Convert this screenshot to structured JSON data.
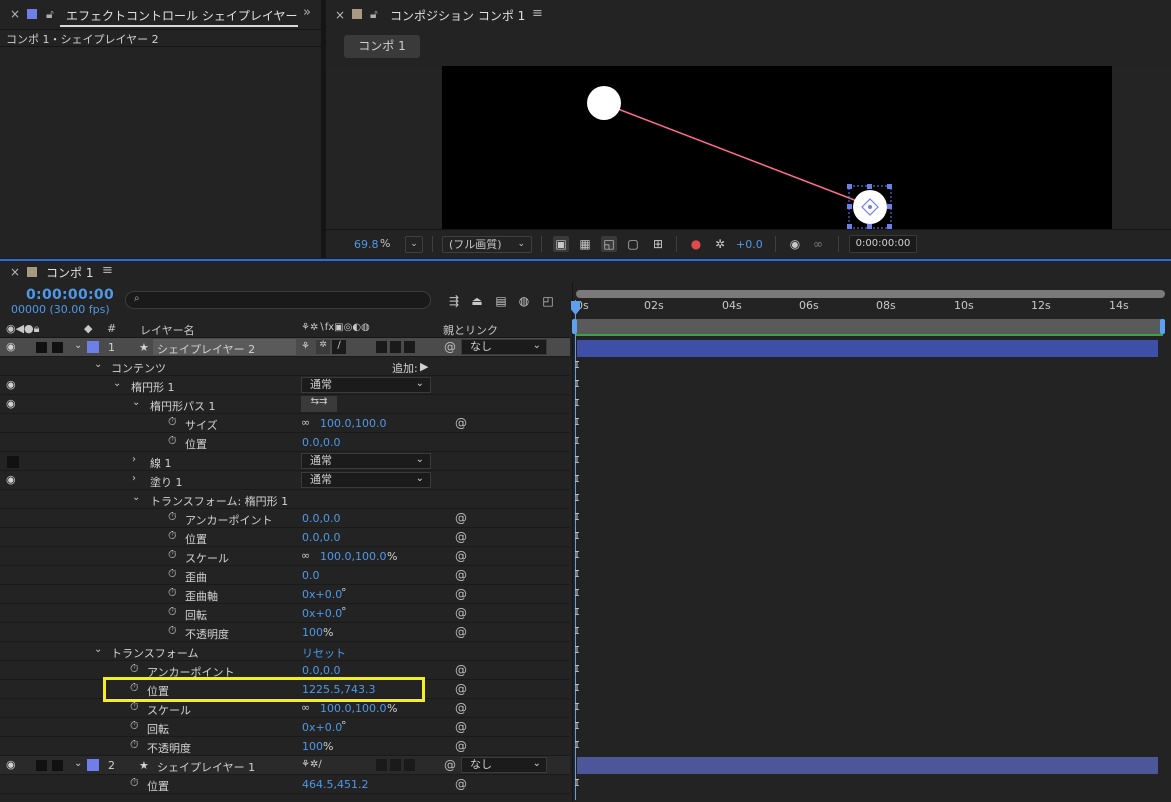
{
  "colors": {
    "accent_blue": "#4f98e7",
    "layer_label_blue": "#6f7fe8",
    "composition_bg": "#000000",
    "path_line": "#ff6b8a",
    "highlight_yellow": "#f4ef20",
    "layer_bar": "#3e4fa8"
  },
  "effects_panel": {
    "close": "×",
    "tab_title": "エフェクトコントロール シェイプレイヤー",
    "overflow": "»",
    "subtitle": "コンポ 1・シェイプレイヤー 2"
  },
  "comp_panel": {
    "close": "×",
    "tab_title": "コンポジション コンポ 1",
    "menu": "≡",
    "flow_button": "コンポ 1",
    "toolbar": {
      "zoom": "69.8",
      "zoom_unit": "%",
      "resolution": "(フル画質)",
      "exposure": "+0.0",
      "timecode": "0:00:00:00"
    }
  },
  "timeline": {
    "tab_close": "×",
    "tab_title": "コンポ 1",
    "menu": "≡",
    "timecode": "0:00:00:00",
    "frames": "00000 (30.00 fps)",
    "search_placeholder": "",
    "header": {
      "num": "#",
      "layer_name": "レイヤー名",
      "switches": "⚘✲∖fx▣◎◐◍",
      "parent": "親とリンク"
    },
    "ruler_ticks": [
      "0s",
      "02s",
      "04s",
      "06s",
      "08s",
      "10s",
      "12s",
      "14s"
    ],
    "layer1": {
      "number": "1",
      "name": "シェイプレイヤー 2",
      "parent": "なし",
      "contents": "コンテンツ",
      "add": "追加:",
      "ellipse": "楕円形 1",
      "ellipse_mode": "通常",
      "ellipse_path": "楕円形パス 1",
      "size_label": "サイズ",
      "size_value": "100.0,100.0",
      "path_pos_label": "位置",
      "path_pos_value": "0.0,0.0",
      "stroke": "線 1",
      "stroke_mode": "通常",
      "fill": "塗り 1",
      "fill_mode": "通常",
      "ellipse_transform": "トランスフォーム: 楕円形 1",
      "et_anchor_label": "アンカーポイント",
      "et_anchor_value": "0.0,0.0",
      "et_pos_label": "位置",
      "et_pos_value": "0.0,0.0",
      "et_scale_label": "スケール",
      "et_scale_value": "100.0,100.0",
      "et_scale_unit": "%",
      "et_skew_label": "歪曲",
      "et_skew_value": "0.0",
      "et_skew_axis_label": "歪曲軸",
      "et_skew_axis_value": "0x+0.0",
      "et_skew_axis_unit": "°",
      "et_rot_label": "回転",
      "et_rot_value": "0x+0.0",
      "et_rot_unit": "°",
      "et_opacity_label": "不透明度",
      "et_opacity_value": "100",
      "et_opacity_unit": "%",
      "transform": "トランスフォーム",
      "reset": "リセット",
      "t_anchor_label": "アンカーポイント",
      "t_anchor_value": "0.0,0.0",
      "t_pos_label": "位置",
      "t_pos_value": "1225.5,743.3",
      "t_scale_label": "スケール",
      "t_scale_value": "100.0,100.0",
      "t_scale_unit": "%",
      "t_rot_label": "回転",
      "t_rot_value": "0x+0.0",
      "t_rot_unit": "°",
      "t_opacity_label": "不透明度",
      "t_opacity_value": "100",
      "t_opacity_unit": "%"
    },
    "layer2": {
      "number": "2",
      "name": "シェイプレイヤー 1",
      "parent": "なし",
      "pos_label": "位置",
      "pos_value": "464.5,451.2"
    }
  }
}
